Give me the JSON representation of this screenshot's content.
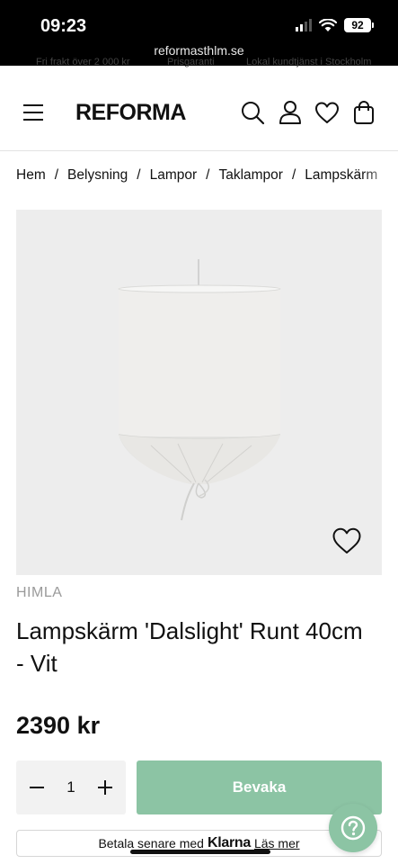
{
  "status_bar": {
    "time": "09:23",
    "battery": "92",
    "url": "reformasthlm.se"
  },
  "promo": {
    "items": [
      "Fri frakt över 2 000 kr",
      "Prisgaranti",
      "Lokal kundtjänst i Stockholm"
    ]
  },
  "header": {
    "logo": "REFORMA",
    "icons": [
      "menu-icon",
      "search-icon",
      "account-icon",
      "heart-icon",
      "cart-icon"
    ]
  },
  "breadcrumb": {
    "items": [
      "Hem",
      "Belysning",
      "Lampor",
      "Taklampor",
      "Lampskärm"
    ],
    "separator": "/"
  },
  "product": {
    "brand": "HIMLA",
    "title": "Lampskärm 'Dalslight' Runt 40cm - Vit",
    "price": "2390 kr",
    "quantity": "1",
    "watch_label": "Bevaka"
  },
  "klarna": {
    "prefix": "Betala senare med",
    "brand": "Klarna",
    "link": "Läs mer"
  },
  "colors": {
    "accent": "#8cc4a4",
    "image_bg": "#ededed"
  }
}
